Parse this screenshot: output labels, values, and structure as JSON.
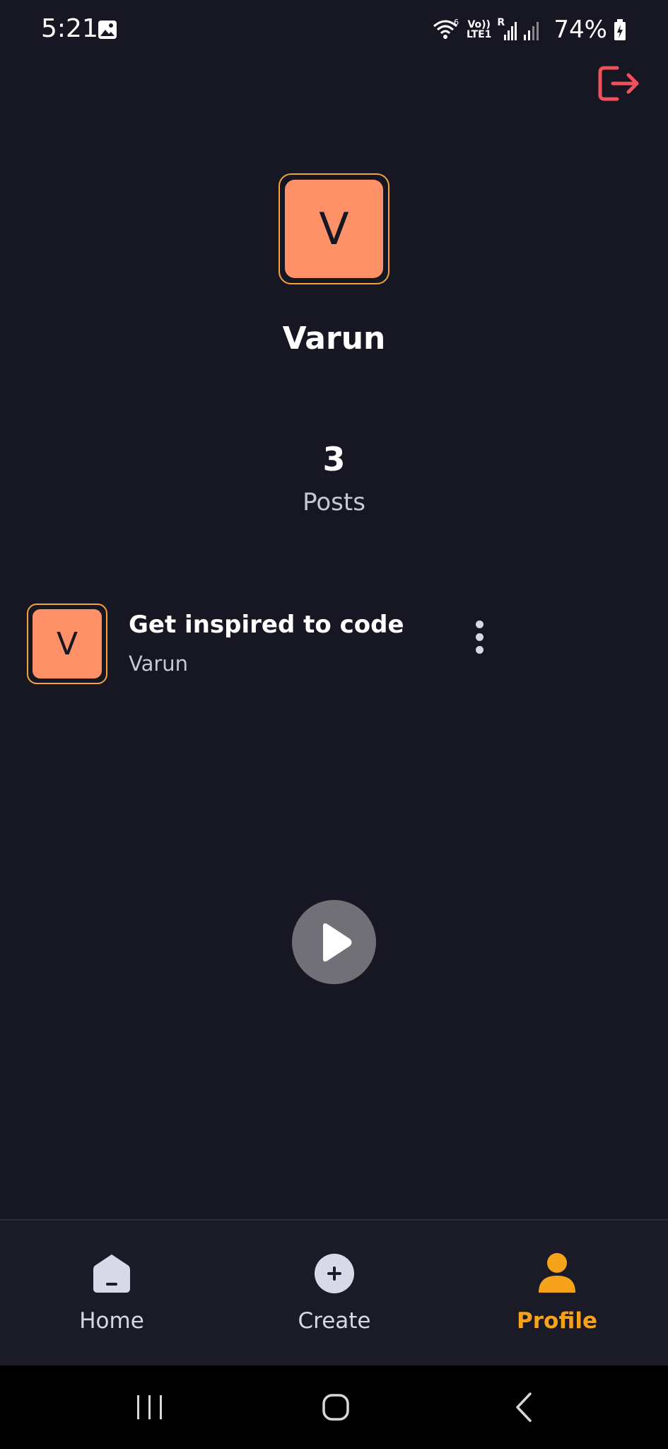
{
  "status_bar": {
    "time": "5:21",
    "wifi_badge": "6",
    "volte_top": "Vo))",
    "volte_bottom": "LTE1",
    "roaming": "R",
    "battery": "74%"
  },
  "profile": {
    "avatar_letter": "V",
    "name": "Varun",
    "posts_count": "3",
    "posts_label": "Posts"
  },
  "post": {
    "avatar_letter": "V",
    "title": "Get inspired to code",
    "author": "Varun"
  },
  "bottom_nav": {
    "items": [
      {
        "label": "Home",
        "icon": "home-icon"
      },
      {
        "label": "Create",
        "icon": "plus-circle-icon"
      },
      {
        "label": "Profile",
        "icon": "person-icon",
        "active": true
      }
    ]
  },
  "colors": {
    "background": "#171723",
    "accent": "#f7a21b",
    "avatar": "#ff9168",
    "logout": "#f0515a"
  }
}
